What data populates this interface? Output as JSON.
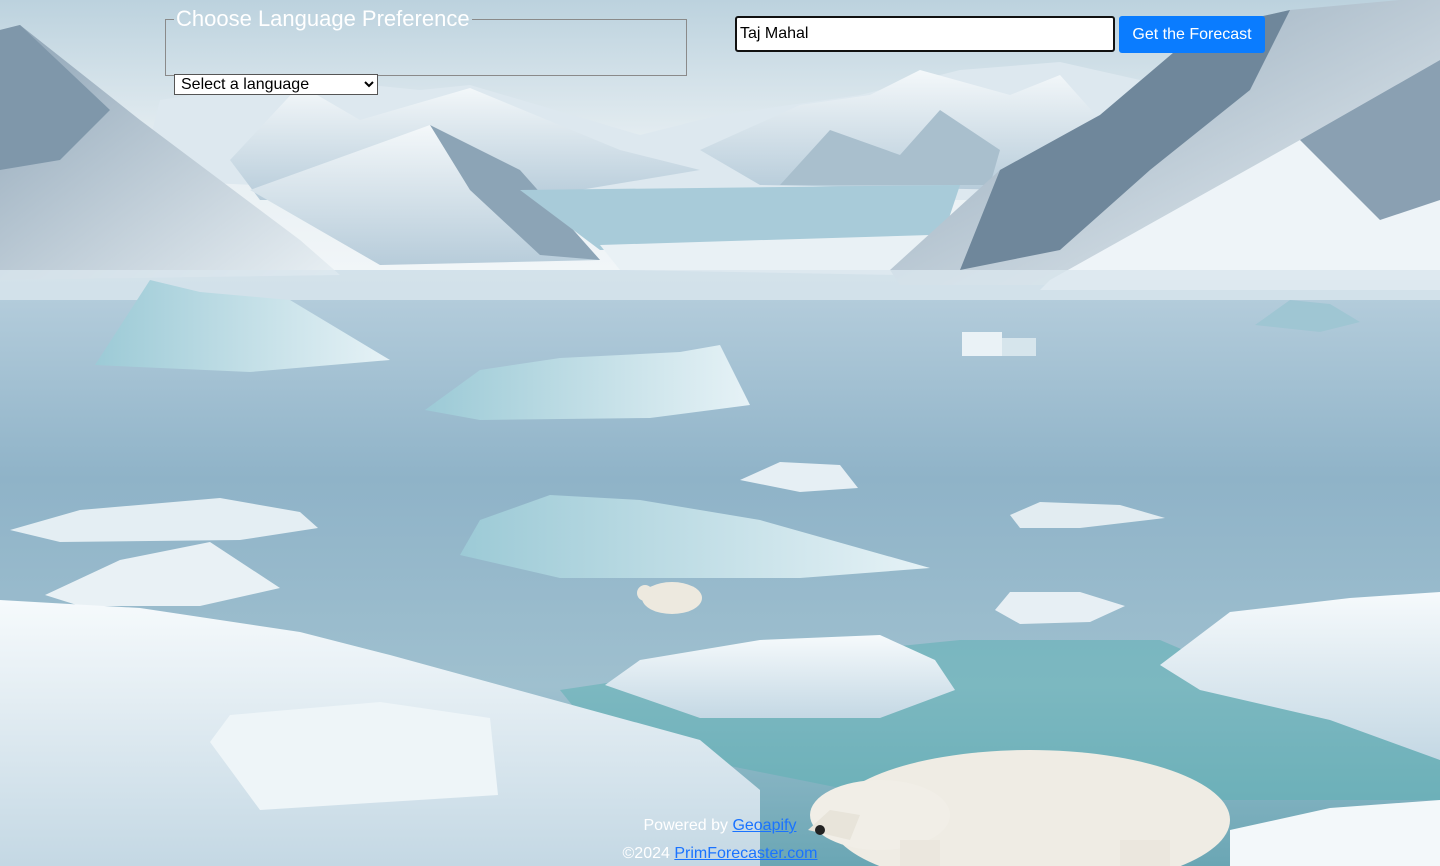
{
  "language": {
    "legend": "Choose Language Preference",
    "selected": "Select a language"
  },
  "search": {
    "value": "Taj Mahal"
  },
  "actions": {
    "forecast_label": "Get the Forecast"
  },
  "footer": {
    "powered_prefix": "Powered by ",
    "powered_link": "Geoapify",
    "copyright_prefix": "©2024 ",
    "site_link": "PrimForecaster.com"
  },
  "colors": {
    "button": "#0a7cff",
    "link": "#1a73ff"
  }
}
